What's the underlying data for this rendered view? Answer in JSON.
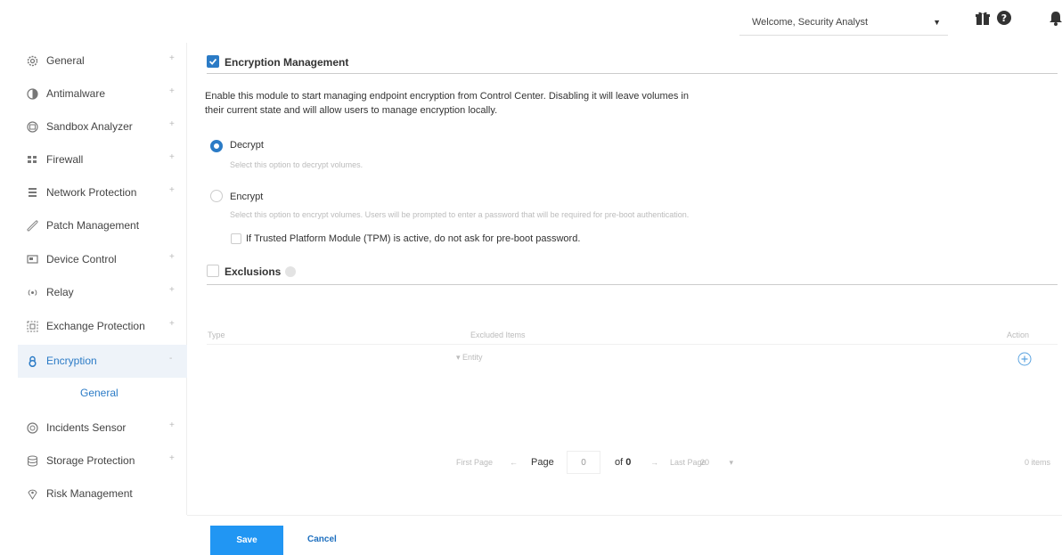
{
  "header": {
    "welcome": "Welcome, Security Analyst",
    "icons": [
      "gift-icon",
      "help-icon",
      "notifications-icon"
    ]
  },
  "sidebar": {
    "items": [
      {
        "label": "General",
        "icon": "gear-icon",
        "expandable": true
      },
      {
        "label": "Antimalware",
        "icon": "antimalware-icon",
        "expandable": true
      },
      {
        "label": "Sandbox Analyzer",
        "icon": "sandbox-icon",
        "expandable": true
      },
      {
        "label": "Firewall",
        "icon": "firewall-icon",
        "expandable": true
      },
      {
        "label": "Network Protection",
        "icon": "network-icon",
        "expandable": true
      },
      {
        "label": "Patch Management",
        "icon": "patch-icon",
        "expandable": false
      },
      {
        "label": "Device Control",
        "icon": "device-icon",
        "expandable": true
      },
      {
        "label": "Relay",
        "icon": "relay-icon",
        "expandable": true
      },
      {
        "label": "Exchange Protection",
        "icon": "exchange-icon",
        "expandable": true
      },
      {
        "label": "Encryption",
        "icon": "lock-icon",
        "expandable": true,
        "active": true
      },
      {
        "label": "Incidents Sensor",
        "icon": "sensor-icon",
        "expandable": true
      },
      {
        "label": "Storage Protection",
        "icon": "storage-icon",
        "expandable": true
      },
      {
        "label": "Risk Management",
        "icon": "risk-icon",
        "expandable": false
      }
    ],
    "sub_item": "General",
    "expand_symbol": "+",
    "collapse_symbol": "-"
  },
  "encryption": {
    "title": "Encryption Management",
    "checked": true,
    "description": "Enable this module to start managing endpoint encryption from Control Center. Disabling it will leave volumes in their current state and will allow users to manage encryption locally.",
    "decrypt_label": "Decrypt",
    "decrypt_hint": "Select this option to decrypt volumes.",
    "encrypt_label": "Encrypt",
    "encrypt_hint": "Select this option to encrypt volumes. Users will be prompted to enter a password that will be required for pre-boot authentication.",
    "tpm_label": "If Trusted Platform Module (TPM) is active, do not ask for pre-boot password.",
    "selected": "decrypt"
  },
  "exclusions": {
    "title": "Exclusions",
    "checked": false,
    "columns": [
      "Type",
      "Excluded Items",
      "Action"
    ],
    "entity_placeholder": "Entity"
  },
  "pagination": {
    "first": "First Page",
    "prev_arrow": "←",
    "page_label": "Page",
    "page_value": "0",
    "of_label": "of",
    "of_value": "0",
    "next_arrow": "→",
    "last": "Last Page",
    "page_size": "20",
    "page_size_caret": "▾",
    "items": "0 items"
  },
  "footer": {
    "save": "Save",
    "cancel": "Cancel"
  },
  "colors": {
    "accent": "#2b7bc6",
    "save_button": "#2196f3"
  }
}
